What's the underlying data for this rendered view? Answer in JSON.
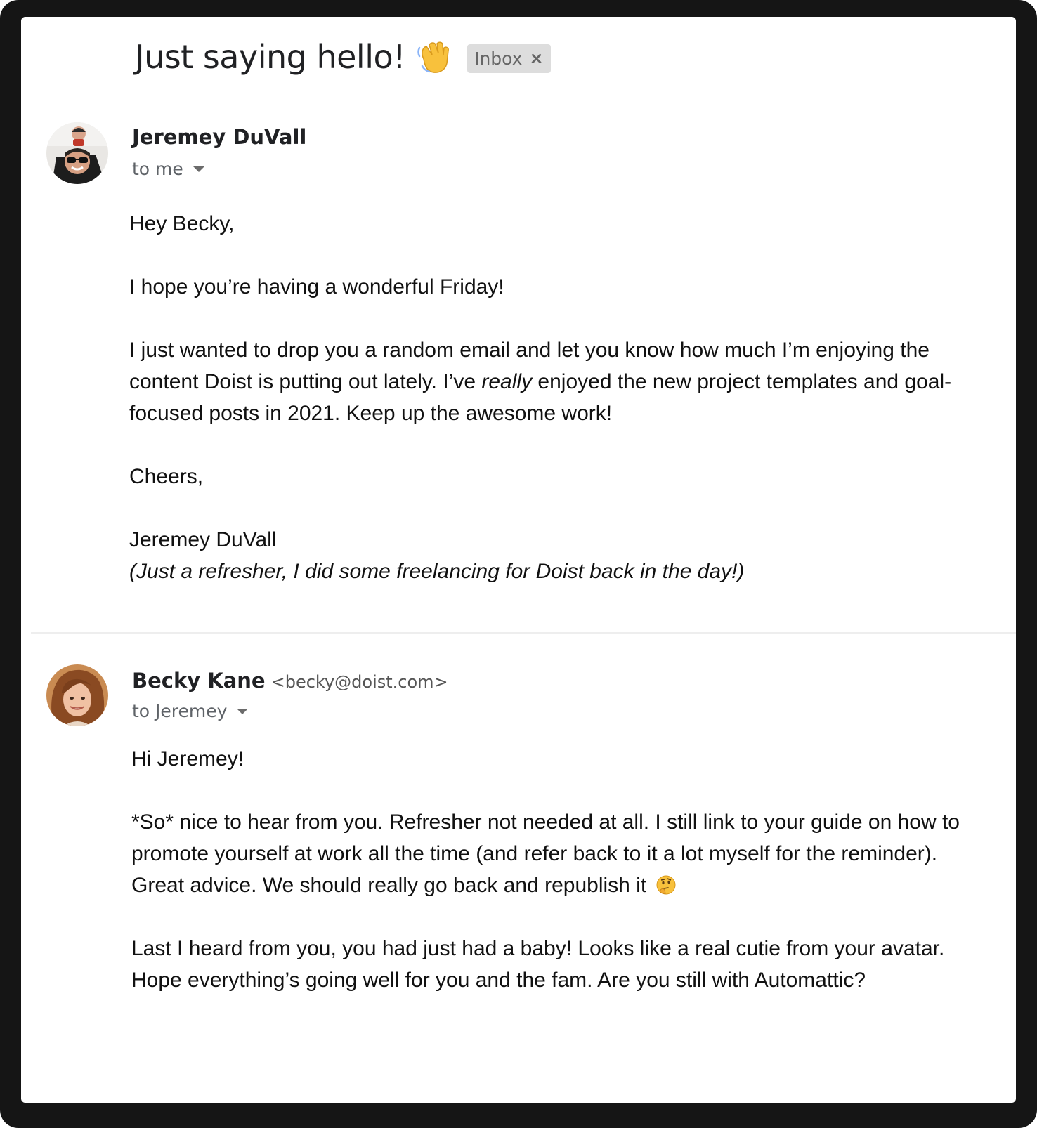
{
  "thread": {
    "subject": "Just saying hello!",
    "subject_emoji": "wave-hand-icon",
    "label": "Inbox"
  },
  "messages": [
    {
      "sender_name": "Jeremey DuVall",
      "sender_email": "",
      "recipient": "to me",
      "avatar": "avatar-man-with-child",
      "greeting": "Hey Becky,",
      "paragraph_1": "I hope you’re having a wonderful Friday!",
      "paragraph_2_start": "I just wanted to drop you a random email and let you know how much I’m enjoying the content Doist is putting out lately. I’ve ",
      "paragraph_2_emphasis": "really",
      "paragraph_2_end": " enjoyed the new project templates and goal-focused posts in 2021. Keep up the awesome work!",
      "signoff": "Cheers,",
      "signature": "Jeremey DuVall",
      "postscript": "(Just a refresher, I did some freelancing for Doist back in the day!)"
    },
    {
      "sender_name": "Becky Kane",
      "sender_email": "<becky@doist.com>",
      "recipient": "to Jeremey",
      "avatar": "avatar-woman",
      "greeting": "Hi Jeremey!",
      "paragraph_1": "*So* nice to hear from you. Refresher not needed at all. I still link to your guide on how to promote yourself at work all the time (and refer back to it a lot myself for the reminder). Great advice. We should really go back and republish it",
      "paragraph_1_emoji": "thinking-face-icon",
      "paragraph_2": "Last I heard from you, you had just had a baby! Looks like a real cutie from your avatar. Hope everything’s going well for you and the fam. Are you still with Automattic?"
    }
  ],
  "colors": {
    "frame": "#151515",
    "card": "#ffffff",
    "text": "#111111",
    "muted": "#5f6368",
    "chip": "#dddddd"
  }
}
